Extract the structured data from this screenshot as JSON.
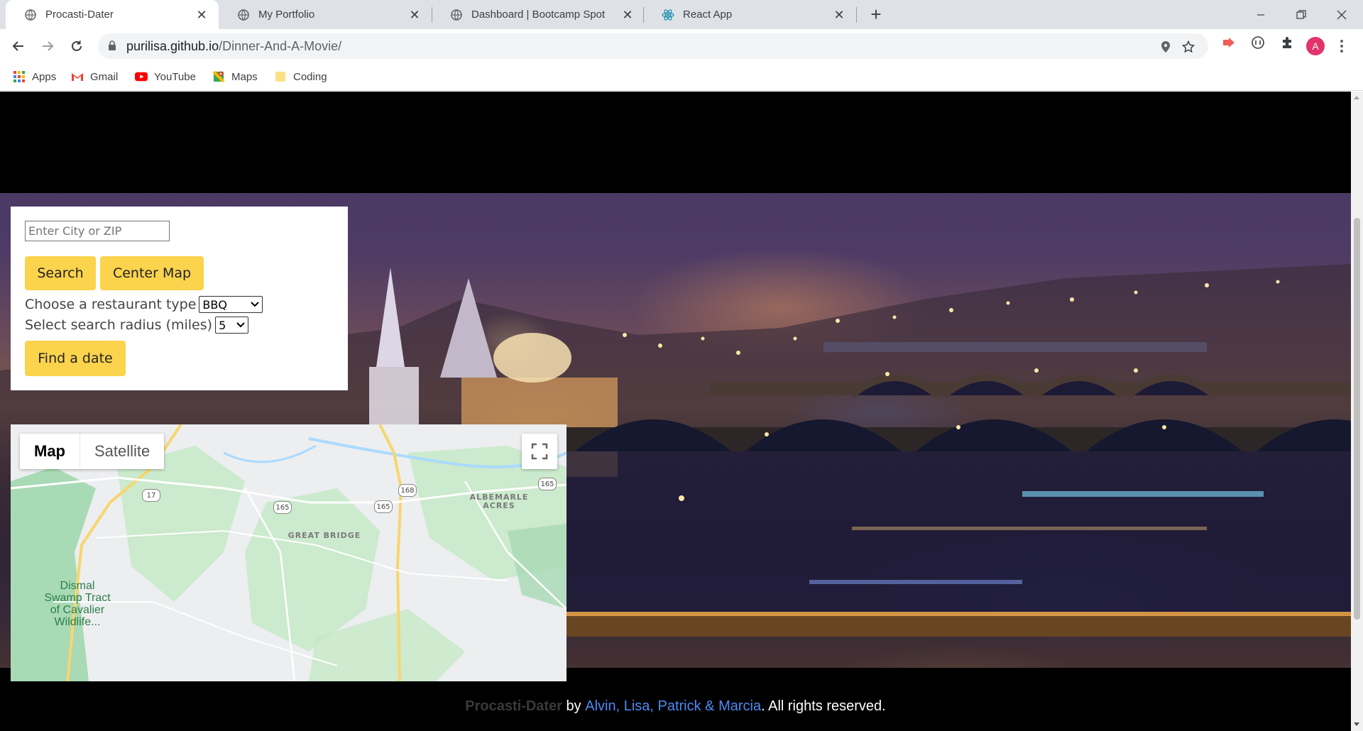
{
  "browser": {
    "tabs": [
      {
        "title": "Procasti-Dater",
        "active": true
      },
      {
        "title": "My Portfolio",
        "active": false
      },
      {
        "title": "Dashboard | Bootcamp Spot",
        "active": false
      },
      {
        "title": "React App",
        "active": false
      }
    ],
    "url_host": "purilisa.github.io",
    "url_path": "/Dinner-And-A-Movie/",
    "profile_initial": "A",
    "bookmarks": [
      {
        "label": "Apps",
        "icon": "apps-grid-icon"
      },
      {
        "label": "Gmail",
        "icon": "gmail-icon"
      },
      {
        "label": "YouTube",
        "icon": "youtube-icon"
      },
      {
        "label": "Maps",
        "icon": "maps-icon"
      },
      {
        "label": "Coding",
        "icon": "folder-icon"
      }
    ]
  },
  "search": {
    "placeholder": "Enter City or ZIP",
    "search_label": "Search",
    "center_map_label": "Center Map",
    "restaurant_label": "Choose a restaurant type",
    "restaurant_value": "BBQ",
    "radius_label": "Select search radius (miles)",
    "radius_value": "5",
    "find_label": "Find a date"
  },
  "map": {
    "map_tab": "Map",
    "satellite_tab": "Satellite",
    "labels": {
      "albemarle": "ALBEMARLE\nACRES",
      "great_bridge": "GREAT BRIDGE",
      "dismal": "Dismal\nSwamp Tract\nof Cavalier\nWildlife..."
    },
    "route_shields": [
      "17",
      "165",
      "165",
      "168",
      "165"
    ]
  },
  "footer": {
    "brand": "Procasti-Dater",
    "by": " by ",
    "authors": "Alvin, Lisa, Patrick & Marcia",
    "rights": ". All rights reserved."
  },
  "colors": {
    "accent_button": "#fbd34c",
    "footer_link": "#4b8bf5",
    "page_background": "#000000"
  }
}
